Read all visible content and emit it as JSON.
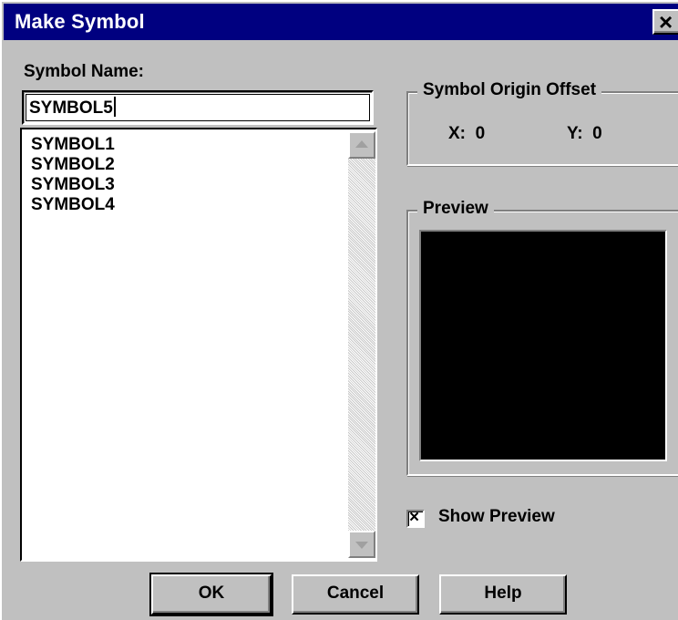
{
  "window": {
    "title": "Make Symbol",
    "close_glyph": "×",
    "close_icon": "close-icon"
  },
  "symbol_name": {
    "label": "Symbol Name:",
    "value": "SYMBOL5"
  },
  "symbol_list": {
    "items": [
      "SYMBOL1",
      "SYMBOL2",
      "SYMBOL3",
      "SYMBOL4"
    ],
    "scroll_up_icon": "scroll-up-arrow-icon",
    "scroll_down_icon": "scroll-down-arrow-icon"
  },
  "origin_offset": {
    "title": "Symbol Origin Offset",
    "x_label": "X:",
    "x_value": "0",
    "y_label": "Y:",
    "y_value": "0"
  },
  "preview": {
    "title": "Preview",
    "background_color": "#000000"
  },
  "show_preview": {
    "label": "Show Preview",
    "checked": true,
    "check_glyph": "×"
  },
  "buttons": {
    "ok": "OK",
    "cancel": "Cancel",
    "help": "Help"
  },
  "colors": {
    "titlebar": "#000080",
    "face": "#c0c0c0",
    "field": "#ffffff"
  }
}
